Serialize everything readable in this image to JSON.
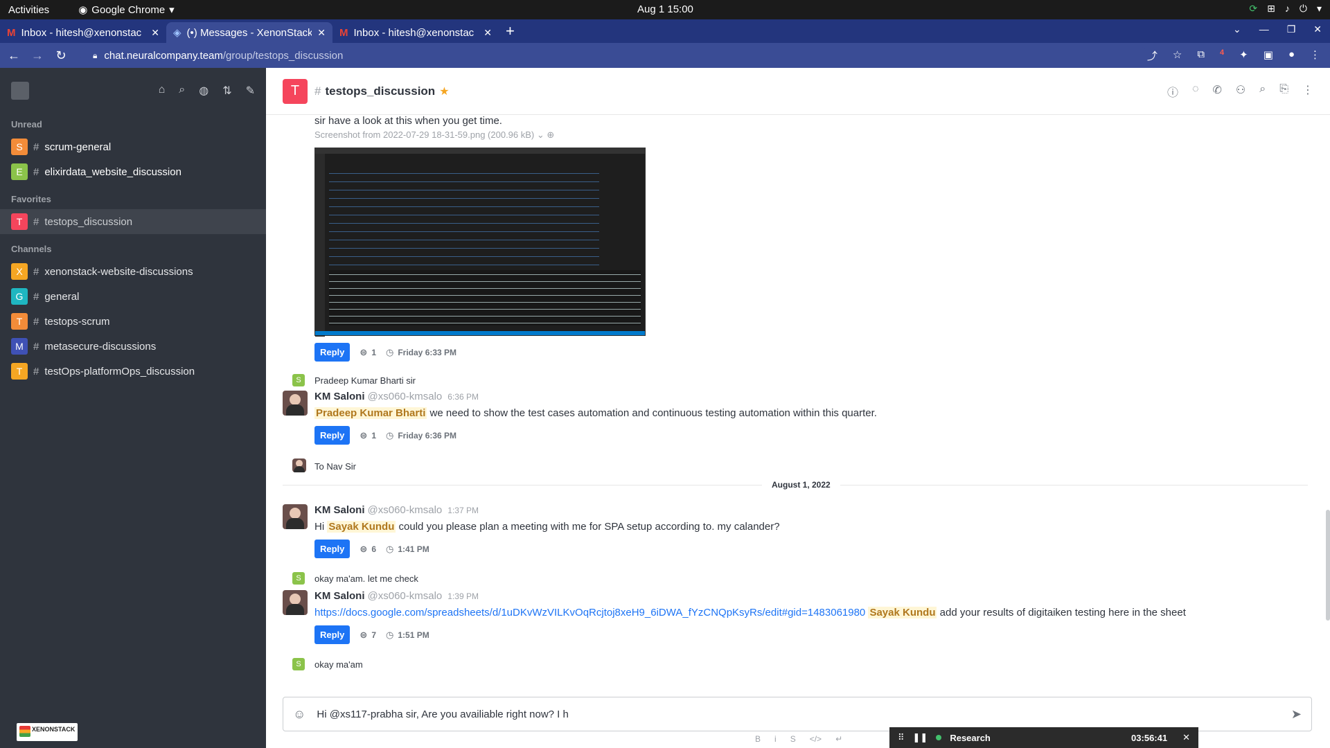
{
  "system": {
    "activities": "Activities",
    "app": "Google Chrome",
    "clock": "Aug 1  15:00"
  },
  "tabs": [
    {
      "title": "Inbox - hitesh@xenonstac"
    },
    {
      "title": "(•) Messages - XenonStack"
    },
    {
      "title": "Inbox - hitesh@xenonstac"
    }
  ],
  "address": {
    "domain": "chat.neuralcompany.team",
    "path": "/group/testops_discussion",
    "ext_badge": "4"
  },
  "sidebar": {
    "unread_label": "Unread",
    "favorites_label": "Favorites",
    "channels_label": "Channels",
    "unread": [
      {
        "initial": "S",
        "name": "scrum-general",
        "color": "#f38c39"
      },
      {
        "initial": "E",
        "name": "elixirdata_website_discussion",
        "color": "#8bc34a"
      }
    ],
    "favorites": [
      {
        "initial": "T",
        "name": "testops_discussion",
        "color": "#f5455c"
      }
    ],
    "channels": [
      {
        "initial": "X",
        "name": "xenonstack-website-discussions",
        "color": "#f5a623"
      },
      {
        "initial": "G",
        "name": "general",
        "color": "#1fb6c1"
      },
      {
        "initial": "T",
        "name": "testops-scrum",
        "color": "#f38c39"
      },
      {
        "initial": "M",
        "name": "metasecure-discussions",
        "color": "#3f51b5"
      },
      {
        "initial": "T",
        "name": "testOps-platformOps_discussion",
        "color": "#f5a623"
      }
    ],
    "logo": "XENONSTACK"
  },
  "room": {
    "initial": "T",
    "name": "testops_discussion"
  },
  "messages": {
    "m0_text": "sir have a look at this when you get time.",
    "m0_file": "Screenshot from 2022-07-29 18-31-59.png (200.96 kB)",
    "m0_reply": "Reply",
    "m0_count": "1",
    "m0_time": "Friday 6:33 PM",
    "m1_name": "Pradeep Kumar Bharti sir",
    "m2_name": "KM Saloni",
    "m2_handle": "@xs060-kmsalo",
    "m2_time": "6:36 PM",
    "m2_mention": "Pradeep Kumar Bharti",
    "m2_text": " we need to show the test cases automation and continuous testing automation within this quarter.",
    "m2_reply": "Reply",
    "m2_count": "1",
    "m2_rtime": "Friday 6:36 PM",
    "m3_text": "To Nav Sir",
    "date_div": "August 1, 2022",
    "m4_name": "KM Saloni",
    "m4_handle": "@xs060-kmsalo",
    "m4_time": "1:37 PM",
    "m4_pre": "Hi ",
    "m4_mention": "Sayak Kundu",
    "m4_text": " could you please plan a meeting with me for SPA setup according to. my calander?",
    "m4_reply": "Reply",
    "m4_count": "6",
    "m4_rtime": "1:41 PM",
    "m5_text": "okay ma'am. let me check",
    "m6_name": "KM Saloni",
    "m6_handle": "@xs060-kmsalo",
    "m6_time": "1:39 PM",
    "m6_link": "https://docs.google.com/spreadsheets/d/1uDKvWzVILKvOqRcjtoj8xeH9_6iDWA_fYzCNQpKsyRs/edit#gid=1483061980",
    "m6_mention": "Sayak Kundu",
    "m6_text": " add your results of digitaiken testing here in the sheet",
    "m6_reply": "Reply",
    "m6_count": "7",
    "m6_rtime": "1:51 PM",
    "m7_text": "okay ma'am"
  },
  "composer": {
    "value": "Hi @xs117-prabha sir, Are you availiable right now? I h"
  },
  "widget": {
    "label": "Research",
    "time": "03:56:41"
  }
}
